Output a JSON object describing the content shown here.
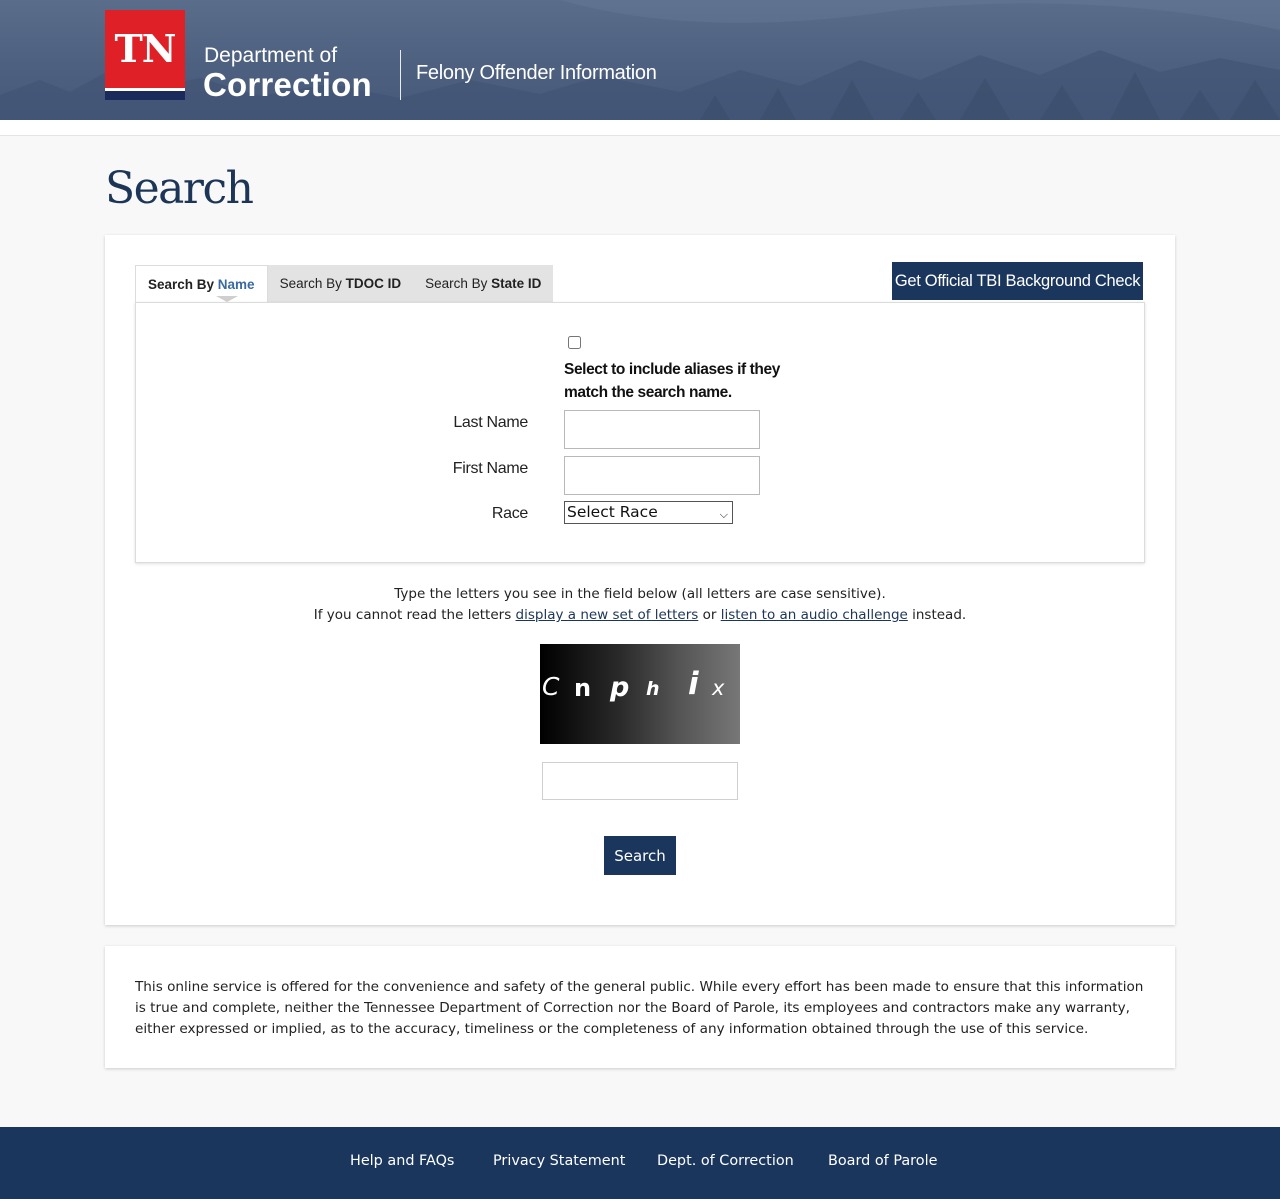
{
  "header": {
    "logo_text": "TN",
    "dept_line1": "Department of",
    "dept_line2": "Correction",
    "subtitle": "Felony Offender Information"
  },
  "page_title": "Search",
  "tabs": [
    {
      "prefix": "Search By ",
      "emphasis": "Name",
      "active": true
    },
    {
      "prefix": "Search By ",
      "emphasis": "TDOC ID",
      "active": false
    },
    {
      "prefix": "Search By ",
      "emphasis": "State ID",
      "active": false
    }
  ],
  "tbi_button_label": "Get Official TBI Background Check",
  "form": {
    "alias_checked": false,
    "alias_label": "Select to include aliases if they match the search name.",
    "last_name_label": "Last Name",
    "last_name_value": "",
    "first_name_label": "First Name",
    "first_name_value": "",
    "race_label": "Race",
    "race_selected": "Select Race"
  },
  "captcha": {
    "instruction": "Type the letters you see in the field below (all letters are case sensitive).",
    "line2_prefix": "If you cannot read the letters ",
    "new_letters_link": "display a new set of letters",
    "line2_middle": " or ",
    "audio_link": "listen to an audio challenge",
    "line2_suffix": " instead.",
    "letters": [
      "C",
      "n",
      "p",
      "h",
      "i",
      "x"
    ],
    "input_value": ""
  },
  "search_button_label": "Search",
  "disclaimer": "This online service is offered for the convenience and safety of the general public. While every effort has been made to ensure that this information is true and complete, neither the Tennessee Department of Correction nor the Board of Parole, its employees and contractors make any warranty, either expressed or implied, as to the accuracy, timeliness or the completeness of any information obtained through the use of this service.",
  "footer_links": [
    "Help and FAQs",
    "Privacy Statement",
    "Dept. of Correction",
    "Board of Parole"
  ],
  "colors": {
    "header_bg": "#4d607f",
    "logo_red": "#e02027",
    "navy": "#1b365d",
    "title_blue": "#1d3557",
    "page_bg": "#f8f8f8"
  }
}
